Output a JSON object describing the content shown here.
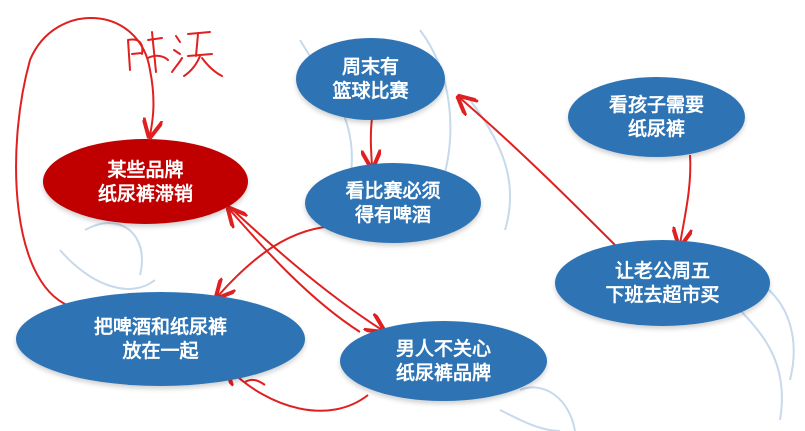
{
  "colors": {
    "node_blue": "#2e74b5",
    "node_red": "#c00000",
    "arrow_red": "#e02020",
    "watermark": "#b9cfe6"
  },
  "nodes": {
    "weekend_game": {
      "text": "周末有\n篮球比赛",
      "color": "#2e74b5"
    },
    "diapers_needed": {
      "text": "看孩子需要\n纸尿裤",
      "color": "#2e74b5"
    },
    "slow_sales": {
      "text": "某些品牌\n纸尿裤滞销",
      "color": "#c00000"
    },
    "beer_needed": {
      "text": "看比赛必须\n得有啤酒",
      "color": "#2e74b5"
    },
    "husband_shops": {
      "text": "让老公周五\n下班去超市买",
      "color": "#2e74b5"
    },
    "place_together": {
      "text": "把啤酒和纸尿裤\n放在一起",
      "color": "#2e74b5"
    },
    "men_indifferent": {
      "text": "男人不关心\n纸尿裤品牌",
      "color": "#2e74b5"
    }
  },
  "handwriting": {
    "text": "解决"
  }
}
